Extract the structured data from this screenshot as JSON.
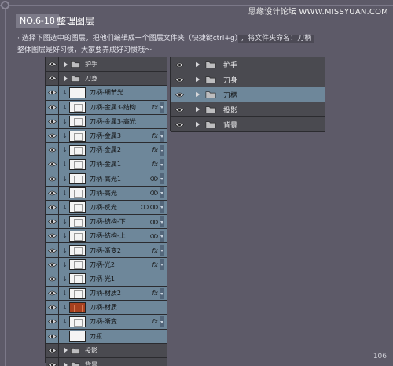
{
  "watermark": "思缘设计论坛 WWW.MISSYUAN.COM",
  "section": {
    "number": "NO.6-18",
    "title": "整理图层"
  },
  "instructions": {
    "line1": "· 选择下图选中的图层，把他们编辑成一个图层文件夹（快捷键ctrl+g）",
    "line1_tail": "，将文件夹命名：刀柄",
    "line2": "整体图层是好习惯，大家要养成好习惯哦～"
  },
  "left_layers": [
    {
      "name": "护手",
      "kind": "group",
      "selected": false
    },
    {
      "name": "刀身",
      "kind": "group",
      "selected": false
    },
    {
      "name": "刀柄-细节光",
      "kind": "layer",
      "selected": true,
      "thumb": "plain",
      "fx": false
    },
    {
      "name": "刀柄-金属3-结构",
      "kind": "layer",
      "selected": true,
      "thumb": "shape",
      "fx": true
    },
    {
      "name": "刀柄-金属3-高光",
      "kind": "layer",
      "selected": true,
      "thumb": "shape",
      "fx": false
    },
    {
      "name": "刀柄-金属3",
      "kind": "layer",
      "selected": true,
      "thumb": "shape",
      "fx": true
    },
    {
      "name": "刀柄-金属2",
      "kind": "layer",
      "selected": true,
      "thumb": "shape",
      "fx": true
    },
    {
      "name": "刀柄-金属1",
      "kind": "layer",
      "selected": true,
      "thumb": "shape",
      "fx": true
    },
    {
      "name": "刀柄-高光1",
      "kind": "layer",
      "selected": true,
      "thumb": "shape",
      "fx": false,
      "style_icon": true
    },
    {
      "name": "刀柄-高光",
      "kind": "layer",
      "selected": true,
      "thumb": "shape",
      "fx": false,
      "style_icon": true
    },
    {
      "name": "刀柄-反光",
      "kind": "layer",
      "selected": true,
      "thumb": "shape",
      "fx": false,
      "style_icon": true,
      "style_icon2": true
    },
    {
      "name": "刀柄-结构-下",
      "kind": "layer",
      "selected": true,
      "thumb": "shape",
      "fx": false,
      "style_icon": true
    },
    {
      "name": "刀柄-结构-上",
      "kind": "layer",
      "selected": true,
      "thumb": "shape",
      "fx": false,
      "style_icon": true
    },
    {
      "name": "刀柄-渐变2",
      "kind": "layer",
      "selected": true,
      "thumb": "shape",
      "fx": true
    },
    {
      "name": "刀柄-光2",
      "kind": "layer",
      "selected": true,
      "thumb": "shape",
      "fx": true
    },
    {
      "name": "刀柄-光1",
      "kind": "layer",
      "selected": true,
      "thumb": "shape",
      "fx": false
    },
    {
      "name": "刀柄-材质2",
      "kind": "layer",
      "selected": true,
      "thumb": "shape",
      "fx": true
    },
    {
      "name": "刀柄-材质1",
      "kind": "layer",
      "selected": true,
      "thumb": "texture",
      "fx": false
    },
    {
      "name": "刀柄-渐变",
      "kind": "layer",
      "selected": true,
      "thumb": "shape",
      "fx": true
    },
    {
      "name": "刀瓶",
      "kind": "layer",
      "selected": true,
      "thumb": "plain",
      "fx": false,
      "no_link": true
    },
    {
      "name": "投影",
      "kind": "group",
      "selected": false
    },
    {
      "name": "背景",
      "kind": "group",
      "selected": false
    }
  ],
  "right_layers": [
    {
      "name": "护手",
      "selected": false
    },
    {
      "name": "刀身",
      "selected": false
    },
    {
      "name": "刀柄",
      "selected": true
    },
    {
      "name": "投影",
      "selected": false
    },
    {
      "name": "背景",
      "selected": false
    }
  ],
  "fx_label": "fx",
  "page_number": "106",
  "colors": {
    "background": "#5d5a68",
    "panel": "#3a3a3f",
    "selected_row": "#6e879a",
    "group_row": "#4a4a50"
  }
}
